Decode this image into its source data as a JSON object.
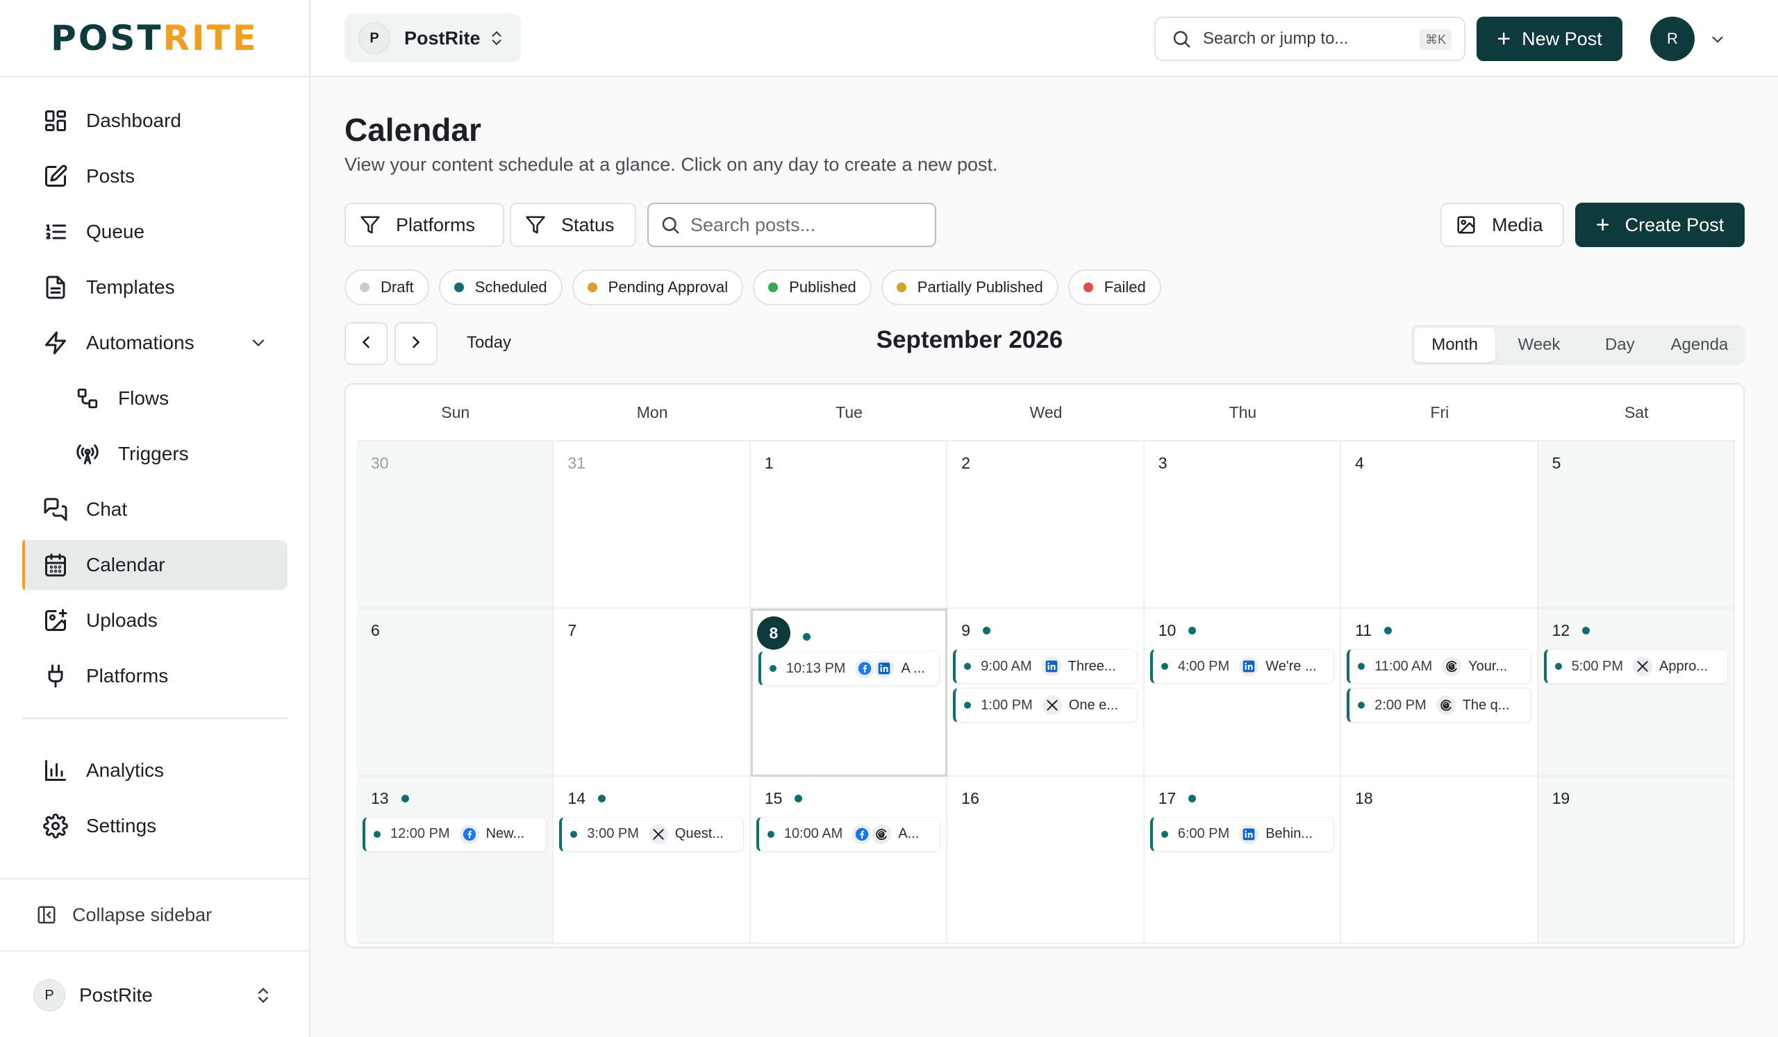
{
  "brand": {
    "logo_part1": "POST",
    "logo_part2": "RITE",
    "accent": "#f0a01e",
    "primary": "#0e3a3c"
  },
  "sidebar": {
    "items": [
      {
        "label": "Dashboard",
        "icon": "dashboard-icon"
      },
      {
        "label": "Posts",
        "icon": "edit-icon"
      },
      {
        "label": "Queue",
        "icon": "list-ordered-icon"
      },
      {
        "label": "Templates",
        "icon": "document-icon"
      },
      {
        "label": "Automations",
        "icon": "lightning-icon",
        "expanded": true
      },
      {
        "label": "Flows",
        "icon": "flow-icon"
      },
      {
        "label": "Triggers",
        "icon": "radio-tower-icon"
      },
      {
        "label": "Chat",
        "icon": "chat-icon"
      },
      {
        "label": "Calendar",
        "icon": "calendar-icon",
        "active": true
      },
      {
        "label": "Uploads",
        "icon": "image-upload-icon"
      },
      {
        "label": "Platforms",
        "icon": "plug-icon"
      },
      {
        "label": "Analytics",
        "icon": "bar-chart-icon"
      },
      {
        "label": "Settings",
        "icon": "gear-icon"
      }
    ],
    "collapse_label": "Collapse sidebar",
    "workspace": {
      "initial": "P",
      "name": "PostRite"
    }
  },
  "topbar": {
    "workspace": {
      "initial": "P",
      "name": "PostRite"
    },
    "search_placeholder": "Search or jump to...",
    "search_shortcut": "⌘K",
    "new_post_label": "New Post",
    "user_initial": "R"
  },
  "page": {
    "title": "Calendar",
    "subtitle": "View your content schedule at a glance. Click on any day to create a new post."
  },
  "filters": {
    "platforms_label": "Platforms",
    "status_label": "Status",
    "search_placeholder": "Search posts...",
    "media_label": "Media",
    "create_label": "Create Post"
  },
  "legend": [
    {
      "label": "Draft",
      "color": "#c9cbcd"
    },
    {
      "label": "Scheduled",
      "color": "#0f6e6e"
    },
    {
      "label": "Pending Approval",
      "color": "#d4a22b"
    },
    {
      "label": "Published",
      "color": "#34a853"
    },
    {
      "label": "Partially Published",
      "color": "#d4a22b"
    },
    {
      "label": "Failed",
      "color": "#e5484d"
    }
  ],
  "calendar": {
    "today_label": "Today",
    "month_title": "September 2026",
    "views": [
      "Month",
      "Week",
      "Day",
      "Agenda"
    ],
    "active_view": "Month",
    "weekdays": [
      "Sun",
      "Mon",
      "Tue",
      "Wed",
      "Thu",
      "Fri",
      "Sat"
    ],
    "weeks": [
      [
        {
          "day": "30",
          "muted": true
        },
        {
          "day": "31",
          "muted": true
        },
        {
          "day": "1"
        },
        {
          "day": "2"
        },
        {
          "day": "3"
        },
        {
          "day": "4"
        },
        {
          "day": "5"
        }
      ],
      [
        {
          "day": "6"
        },
        {
          "day": "7"
        },
        {
          "day": "8",
          "today": true,
          "events": [
            {
              "time": "10:13 PM",
              "platforms": [
                "facebook",
                "linkedin"
              ],
              "text": "A ..."
            }
          ]
        },
        {
          "day": "9",
          "events": [
            {
              "time": "9:00 AM",
              "platforms": [
                "linkedin"
              ],
              "text": "Three..."
            },
            {
              "time": "1:00 PM",
              "platforms": [
                "x"
              ],
              "text": "One e..."
            }
          ]
        },
        {
          "day": "10",
          "events": [
            {
              "time": "4:00 PM",
              "platforms": [
                "linkedin"
              ],
              "text": "We're ..."
            }
          ]
        },
        {
          "day": "11",
          "events": [
            {
              "time": "11:00 AM",
              "platforms": [
                "threads"
              ],
              "text": "Your..."
            },
            {
              "time": "2:00 PM",
              "platforms": [
                "threads"
              ],
              "text": "The q..."
            }
          ]
        },
        {
          "day": "12",
          "events": [
            {
              "time": "5:00 PM",
              "platforms": [
                "x"
              ],
              "text": "Appro..."
            }
          ]
        }
      ],
      [
        {
          "day": "13",
          "events": [
            {
              "time": "12:00 PM",
              "platforms": [
                "facebook"
              ],
              "text": "New..."
            }
          ]
        },
        {
          "day": "14",
          "events": [
            {
              "time": "3:00 PM",
              "platforms": [
                "x"
              ],
              "text": "Quest..."
            }
          ]
        },
        {
          "day": "15",
          "events": [
            {
              "time": "10:00 AM",
              "platforms": [
                "facebook",
                "threads"
              ],
              "text": "A..."
            }
          ]
        },
        {
          "day": "16"
        },
        {
          "day": "17",
          "events": [
            {
              "time": "6:00 PM",
              "platforms": [
                "linkedin"
              ],
              "text": "Behin..."
            }
          ]
        },
        {
          "day": "18"
        },
        {
          "day": "19"
        }
      ]
    ]
  }
}
